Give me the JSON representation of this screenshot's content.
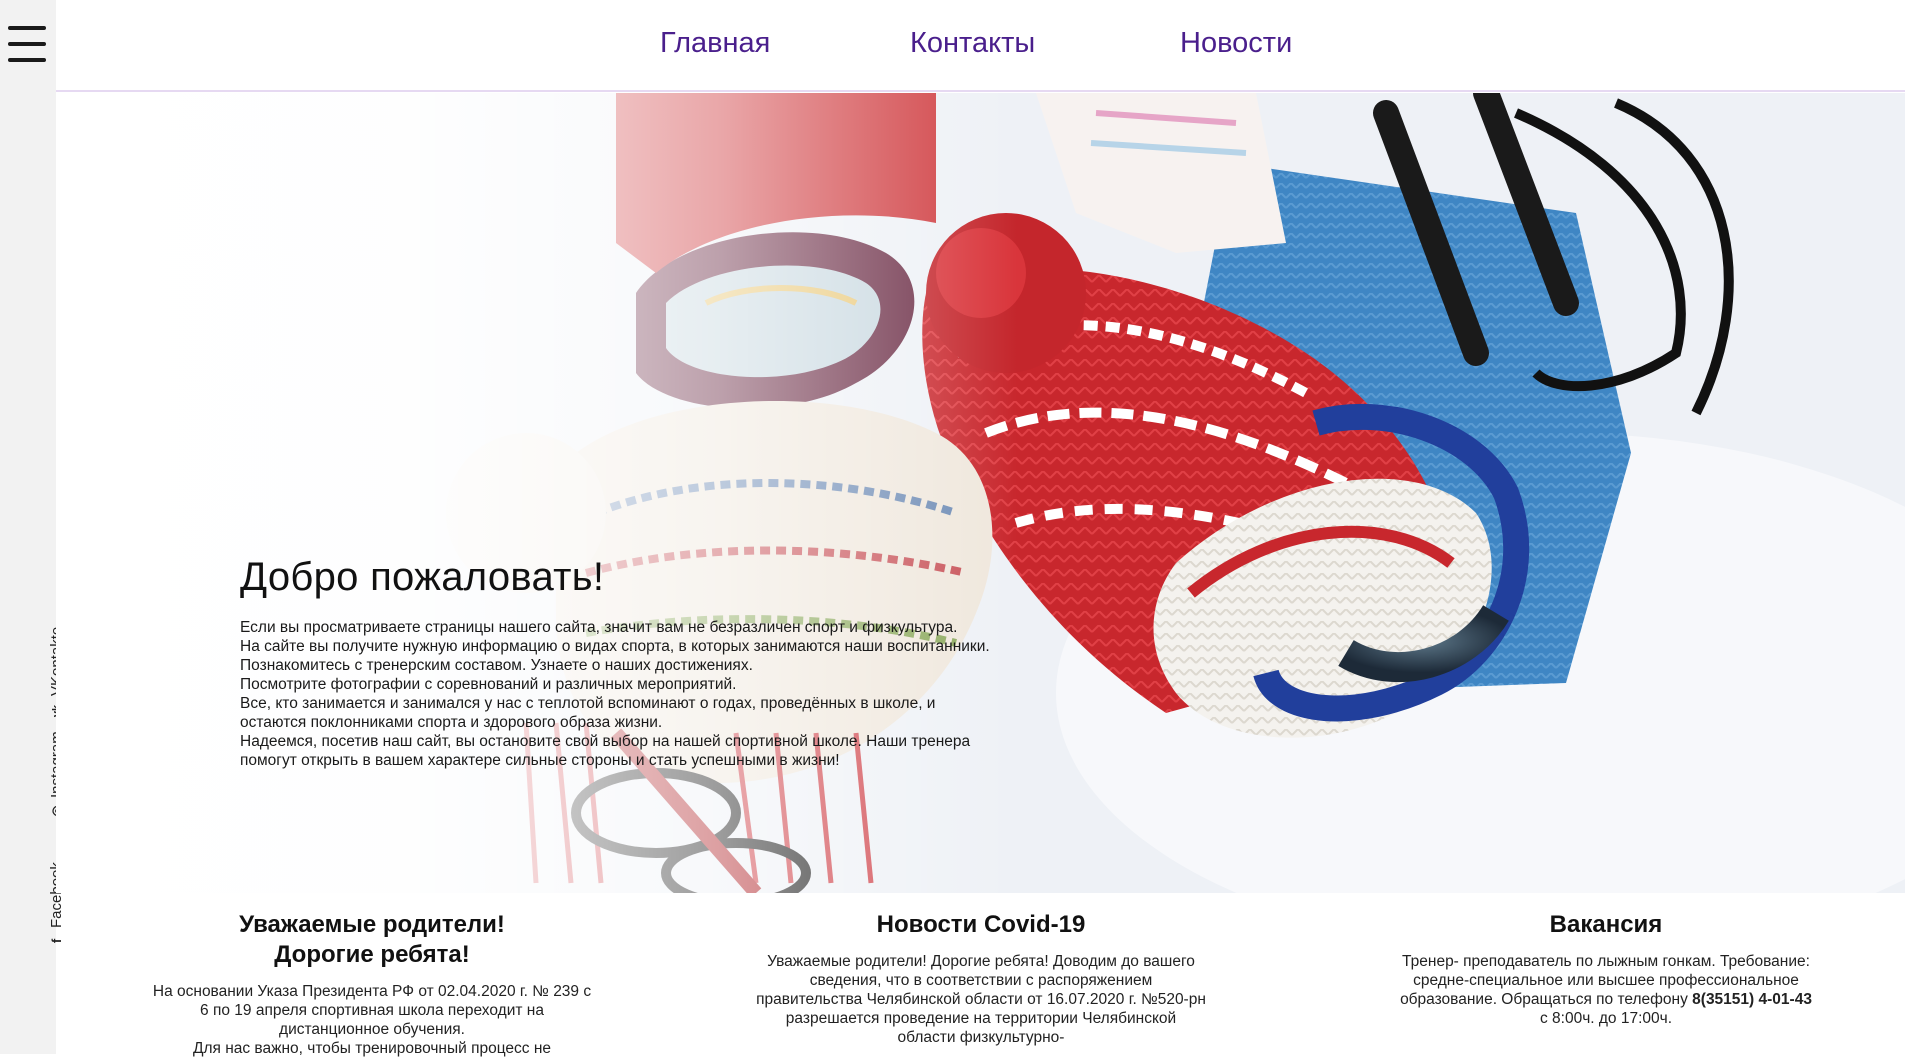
{
  "nav": {
    "menu_icon": "hamburger-icon",
    "items": [
      "Главная",
      "Контакты",
      "Новости"
    ]
  },
  "social": [
    {
      "label": "Facebook",
      "icon": "facebook-icon",
      "glyph": "f"
    },
    {
      "label": "Instagram",
      "icon": "instagram-icon",
      "glyph": "◎"
    },
    {
      "label": "VKontakte",
      "icon": "vk-icon",
      "glyph": "vk"
    }
  ],
  "hero": {
    "title": "Добро пожаловать!",
    "paragraphs": [
      "Если вы просматриваете страницы нашего сайта, значит вам не безразличен спорт и физкультура.",
      "На сайте вы получите нужную информацию о видах спорта, в которых занимаются наши воспитанники. Познакомитесь с тренерским составом. Узнаете о наших достижениях.",
      "Посмотрите фотографии с соревнований и различных мероприятий.",
      "Все, кто занимается и занимался у нас с теплотой вспоминают о годах, проведённых в школе, и остаются поклонниками спорта и здорового образа жизни.",
      "Надеемся, посетив наш сайт, вы остановите свой выбор на нашей спортивной школе. Наши тренера помогут открыть в вашем характере сильные стороны и стать успешными в жизни!"
    ]
  },
  "columns": [
    {
      "title_line1": "Уважаемые родители!",
      "title_line2": "Дорогие ребята!",
      "text_1": "На основании Указа Президента РФ от 02.04.2020 г. № 239 с 6 по 19 апреля спортивная школа переходит на дистанционное обучения.",
      "text_2": "Для нас важно, чтобы тренировочный процесс не"
    },
    {
      "title_line1": "Новости Covid-19",
      "text_1": "Уважаемые родители! Дорогие ребята! Доводим до вашего сведения, что в соответствии с распоряжением правительства Челябинской области от 16.07.2020 г. №520-рн разрешается проведение на территории Челябинской области физкультурно-"
    },
    {
      "title_line1": "Вакансия",
      "text_1": "Тренер- преподаватель по лыжным гонкам. Требование: средне-специальное или высшее профессиональное образование. Обращаться по телефону",
      "phone": "8(35151) 4-01-43",
      "hours": "с 8:00ч. до 17:00ч."
    }
  ]
}
